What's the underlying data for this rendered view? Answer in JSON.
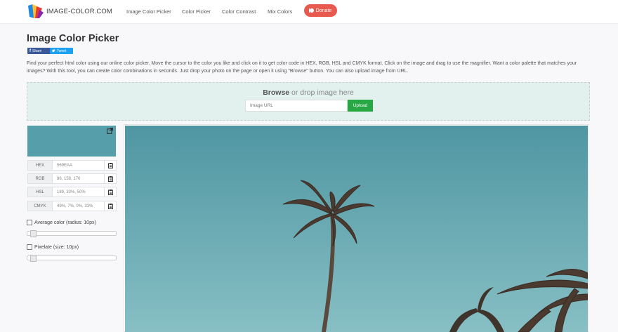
{
  "navbar": {
    "brand": "IMAGE-COLOR.COM",
    "links": [
      "Image Color Picker",
      "Color Picker",
      "Color Contrast",
      "Mix Colors"
    ],
    "donate_label": "Donate",
    "donate_color": "#e85a4f"
  },
  "page": {
    "title": "Image Color Picker",
    "share_facebook": "Share",
    "share_twitter": "Tweet",
    "description": "Find your perfect html color using our online color picker. Move the cursor to the color you like and click on it to get color code in HEX, RGB, HSL and CMYK format. Click on the image and drag to use the magnifier. Want a color palette that matches your images? With this tool, you can create color combinations in seconds. Just drop your photo on the page or open it using \"Browse\" button. You can also upload image from URL."
  },
  "dropzone": {
    "browse": "Browse",
    "rest": " or drop image here",
    "url_placeholder": "Image URL",
    "upload_label": "Upload"
  },
  "picker": {
    "swatch_color": "#569EAA",
    "rows": [
      {
        "label": "HEX",
        "value": "569EAA"
      },
      {
        "label": "RGB",
        "value": "86, 158, 170"
      },
      {
        "label": "HSL",
        "value": "189, 33%, 50%"
      },
      {
        "label": "CMYK",
        "value": "49%, 7%, 0%, 33%"
      }
    ],
    "average_label": "Average color (radius: 10px)",
    "pixelate_label": "Pixelate (size: 10px)"
  },
  "icons": {
    "external": "external-link-icon",
    "copy": "clipboard-icon",
    "logo": "logo-icon",
    "donate": "patreon-icon"
  },
  "colors": {
    "accent": "#28a745",
    "sky_top": "#4f96a2",
    "sky_bottom": "#87bfc4"
  }
}
